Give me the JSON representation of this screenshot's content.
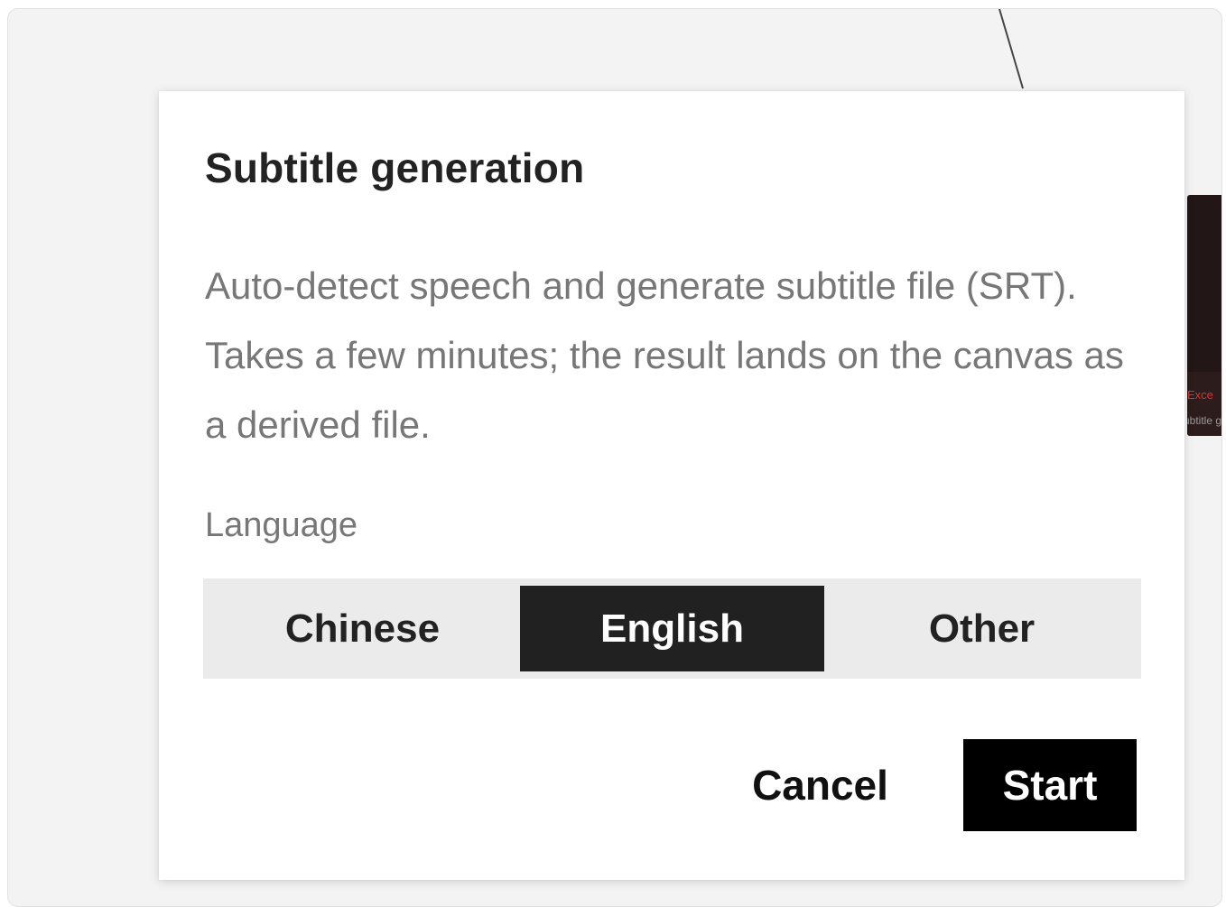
{
  "background_card": {
    "line1": "Exce",
    "line2": "ubtitle g"
  },
  "dialog": {
    "title": "Subtitle generation",
    "description": "Auto-detect speech and generate subtitle file (SRT). Takes a few minutes; the result lands on the canvas as a derived file.",
    "language_label": "Language",
    "language_options": [
      {
        "label": "Chinese",
        "selected": false
      },
      {
        "label": "English",
        "selected": true
      },
      {
        "label": "Other",
        "selected": false
      }
    ],
    "cancel_label": "Cancel",
    "start_label": "Start"
  },
  "colors": {
    "selected_option_bg": "#212121",
    "primary_button_bg": "#000000",
    "accent_red": "#e03030"
  }
}
